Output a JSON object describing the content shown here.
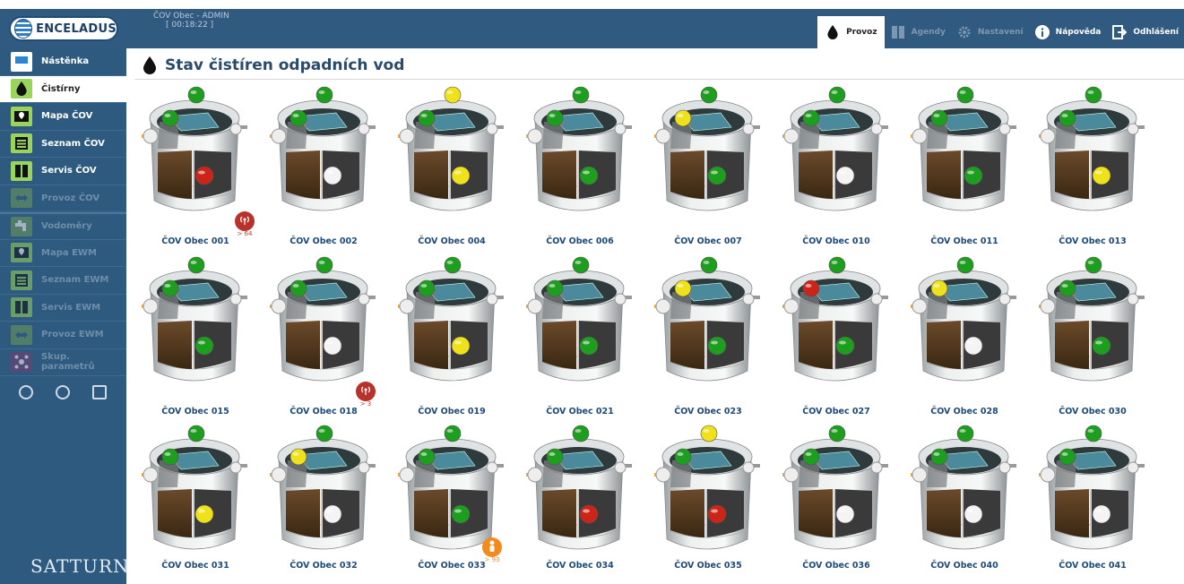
{
  "header": {
    "logo_text": "ENCELADUS",
    "user": "ČOV Obec - ADMIN",
    "timer": "[ 00:18:22 ]",
    "nav": [
      {
        "label": "Provoz",
        "icon": "drop-icon",
        "state": "active"
      },
      {
        "label": "Agendy",
        "icon": "binders-icon",
        "state": "dim"
      },
      {
        "label": "Nastavení",
        "icon": "gear-icon",
        "state": "dim"
      },
      {
        "label": "Nápověda",
        "icon": "info-icon",
        "state": "normal"
      },
      {
        "label": "Odhlášení",
        "icon": "logout-icon",
        "state": "normal"
      }
    ]
  },
  "sidebar": {
    "items": [
      {
        "label": "Nástěnka",
        "icon": "monitor-icon",
        "state": "normal"
      },
      {
        "label": "Čistírny",
        "icon": "drop-icon",
        "state": "active"
      },
      {
        "label": "Mapa ČOV",
        "icon": "map-pin-icon",
        "state": "normal"
      },
      {
        "label": "Seznam ČOV",
        "icon": "list-icon",
        "state": "normal"
      },
      {
        "label": "Servis ČOV",
        "icon": "binders-icon",
        "state": "normal"
      },
      {
        "label": "Provoz ČOV",
        "icon": "arrows-icon",
        "state": "dim"
      },
      {
        "label": "Vodoměry",
        "icon": "faucet-icon",
        "state": "dim"
      },
      {
        "label": "Mapa EWM",
        "icon": "map-pin-icon",
        "state": "dim"
      },
      {
        "label": "Seznam EWM",
        "icon": "list-icon",
        "state": "dim"
      },
      {
        "label": "Servis EWM",
        "icon": "binders-icon",
        "state": "dim"
      },
      {
        "label": "Provoz EWM",
        "icon": "arrows-icon",
        "state": "dim"
      },
      {
        "label": "Skup. parametrů",
        "icon": "group-icon",
        "state": "dim"
      }
    ],
    "footer_icons": [
      "compass-icon",
      "user-icon",
      "logout-icon"
    ],
    "brand": "SATTURN"
  },
  "page": {
    "title": "Stav čistíren odpadních vod",
    "title_icon": "drop-icon"
  },
  "colors": {
    "green": "#1e9e1e",
    "yellow": "#f0e21a",
    "red": "#cc2418",
    "white": "#f4f4f4"
  },
  "plants": [
    {
      "name": "ČOV Obec 001",
      "top": "green",
      "mid": "green",
      "low": "red",
      "badge": {
        "type": "red",
        "icon": "antenna-icon",
        "count": "> 64"
      }
    },
    {
      "name": "ČOV Obec 002",
      "top": "green",
      "mid": "green",
      "low": "white"
    },
    {
      "name": "ČOV Obec 004",
      "top": "yellow",
      "mid": "green",
      "low": "yellow"
    },
    {
      "name": "ČOV Obec 006",
      "top": "green",
      "mid": "green",
      "low": "green"
    },
    {
      "name": "ČOV Obec 007",
      "top": "green",
      "mid": "yellow",
      "low": "green"
    },
    {
      "name": "ČOV Obec 010",
      "top": "green",
      "mid": "green",
      "low": "white"
    },
    {
      "name": "ČOV Obec 011",
      "top": "green",
      "mid": "green",
      "low": "green"
    },
    {
      "name": "ČOV Obec 013",
      "top": "green",
      "mid": "green",
      "low": "yellow"
    },
    {
      "name": "ČOV Obec 015",
      "top": "green",
      "mid": "green",
      "low": "green"
    },
    {
      "name": "ČOV Obec 018",
      "top": "green",
      "mid": "green",
      "low": "white",
      "badge": {
        "type": "red",
        "icon": "antenna-icon",
        "count": "> 3"
      }
    },
    {
      "name": "ČOV Obec 019",
      "top": "green",
      "mid": "green",
      "low": "yellow"
    },
    {
      "name": "ČOV Obec 021",
      "top": "green",
      "mid": "green",
      "low": "green"
    },
    {
      "name": "ČOV Obec 023",
      "top": "green",
      "mid": "yellow",
      "low": "green"
    },
    {
      "name": "ČOV Obec 027",
      "top": "green",
      "mid": "red",
      "low": "green"
    },
    {
      "name": "ČOV Obec 028",
      "top": "green",
      "mid": "yellow",
      "low": "white"
    },
    {
      "name": "ČOV Obec 030",
      "top": "green",
      "mid": "green",
      "low": "green"
    },
    {
      "name": "ČOV Obec 031",
      "top": "green",
      "mid": "green",
      "low": "yellow"
    },
    {
      "name": "ČOV Obec 032",
      "top": "green",
      "mid": "yellow",
      "low": "white"
    },
    {
      "name": "ČOV Obec 033",
      "top": "green",
      "mid": "green",
      "low": "green",
      "badge": {
        "type": "orange",
        "icon": "person-icon",
        "count": "> 93"
      }
    },
    {
      "name": "ČOV Obec 034",
      "top": "green",
      "mid": "green",
      "low": "red"
    },
    {
      "name": "ČOV Obec 035",
      "top": "yellow",
      "mid": "green",
      "low": "red"
    },
    {
      "name": "ČOV Obec 036",
      "top": "green",
      "mid": "green",
      "low": "white"
    },
    {
      "name": "ČOV Obec 040",
      "top": "green",
      "mid": "green",
      "low": "white"
    },
    {
      "name": "ČOV Obec 041",
      "top": "green",
      "mid": "green",
      "low": "white"
    }
  ]
}
